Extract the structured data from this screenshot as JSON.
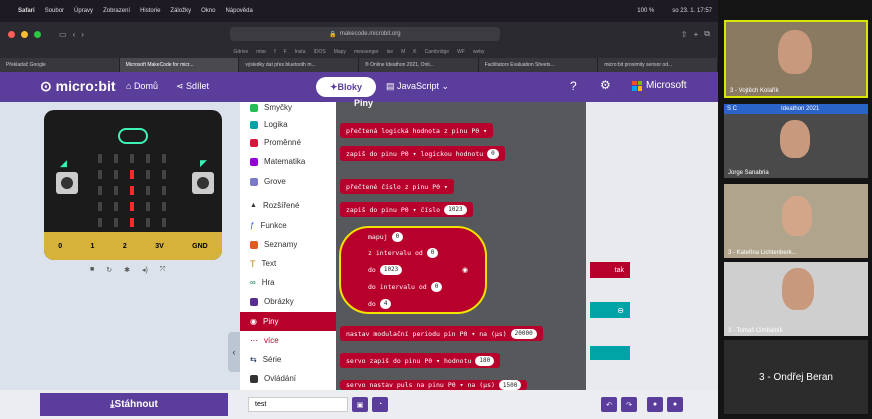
{
  "menubar": {
    "app": "Safari",
    "items": [
      "Soubor",
      "Úpravy",
      "Zobrazení",
      "Historie",
      "Záložky",
      "Okno",
      "Nápověda"
    ],
    "battery": "100 %",
    "clock": "so 23. 1.  17:57"
  },
  "browser": {
    "url": "makecode.microbit.org",
    "bookmarks": [
      "Gdrive",
      "mtar",
      "f",
      "F",
      "Insta",
      "IDOS",
      "Mapy",
      "messenger",
      "ise",
      "M",
      "K",
      "Cambridge",
      "WF",
      "weby"
    ],
    "tabs": [
      "Překladač Google",
      "Microsoft MakeCode for micr...",
      "výsledky dat přes bluetooth m...",
      "® Online Ideathon 2021, Onli...",
      "Facilitators Evaluation Sheets...",
      "micro:bit proximity sensor od..."
    ]
  },
  "makecode": {
    "logo": "micro:bit",
    "home": "Domů",
    "share": "Sdílet",
    "blocks_tab": "Bloky",
    "js_tab": "JavaScript",
    "microsoft": "Microsoft",
    "pins": [
      "0",
      "1",
      "2",
      "3V",
      "GND"
    ],
    "toolbox": [
      "Smyčky",
      "Logika",
      "Proměnné",
      "Matematika",
      "Grove",
      "Rozšířené",
      "Funkce",
      "Seznamy",
      "Text",
      "Hra",
      "Obrázky",
      "Piny",
      "více",
      "Série",
      "Ovládání"
    ],
    "flyout_title": "Piny",
    "blocks": {
      "b1": "přečtená logická hodnota z pinu",
      "b1_pin": "P0 ▾",
      "b2": "zapiš do pinu",
      "b2_pin": "P0 ▾",
      "b2_tail": "logickou hodnotu",
      "b2_val": "0",
      "b3": "přečtené číslo z pinu",
      "b3_pin": "P0 ▾",
      "b4": "zapiš do pinu",
      "b4_pin": "P0 ▾",
      "b4_tail": "číslo",
      "b4_val": "1023",
      "map_label": "mapuj",
      "map_val": "0",
      "map_from": "z intervalu od",
      "map_from_val": "0",
      "map_to": "do",
      "map_to_val": "1023",
      "map_to2": "do intervalu od",
      "map_to2_val": "0",
      "map_to3": "do",
      "map_to3_val": "4",
      "b6": "nastav modulační periodu pin",
      "b6_pin": "P0 ▾",
      "b6_tail": "na (µs)",
      "b6_val": "20000",
      "b7": "servo zapiš do pinu",
      "b7_pin": "P0 ▾",
      "b7_tail": "hodnotu",
      "b7_val": "180",
      "b8": "servo nastav puls na pinu",
      "b8_pin": "P0 ▾",
      "b8_tail": "na (µs)",
      "b8_val": "1500",
      "behind": "tak"
    },
    "download": "Stáhnout",
    "project_name": "test"
  },
  "video": {
    "tiles": [
      "3 - Vojtěch Kolařík",
      "Ideathon 2021",
      "Jorge Sanabria",
      "3 - Kateřina Lichtenberk...",
      "3 - Tomáš Cimbálník",
      "3 - Ondřej Beran"
    ]
  }
}
